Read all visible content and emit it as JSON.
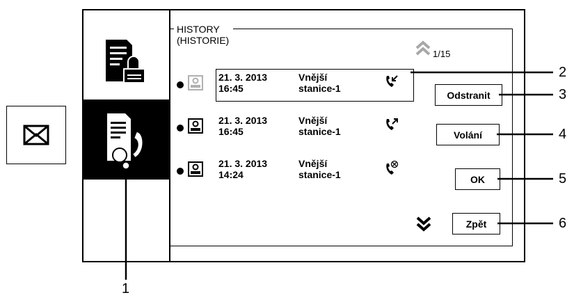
{
  "panel": {
    "title_line1": "HISTORY",
    "title_line2": "(HISTORIE)"
  },
  "pagination": {
    "page": "1/15"
  },
  "rows": [
    {
      "date": "21. 3. 2013",
      "time": "16:45",
      "source_line1": "Vnější",
      "source_line2": "stanice-1",
      "call_icon": "missed-call-icon",
      "selected": true
    },
    {
      "date": "21. 3. 2013",
      "time": "16:45",
      "source_line1": "Vnější",
      "source_line2": "stanice-1",
      "call_icon": "outgoing-call-icon",
      "selected": false
    },
    {
      "date": "21. 3. 2013",
      "time": "14:24",
      "source_line1": "Vnější",
      "source_line2": "stanice-1",
      "call_icon": "rejected-call-icon",
      "selected": false
    }
  ],
  "buttons": {
    "delete": "Odstranit",
    "call": "Volání",
    "ok": "OK",
    "back": "Zpět"
  },
  "callouts": [
    "1",
    "2",
    "3",
    "4",
    "5",
    "6"
  ],
  "sidebar": {
    "items": [
      "messages-icon",
      "call-history-icon"
    ]
  },
  "colors": {
    "active_bg": "#000000",
    "dim_icon": "#b0b0b0"
  }
}
